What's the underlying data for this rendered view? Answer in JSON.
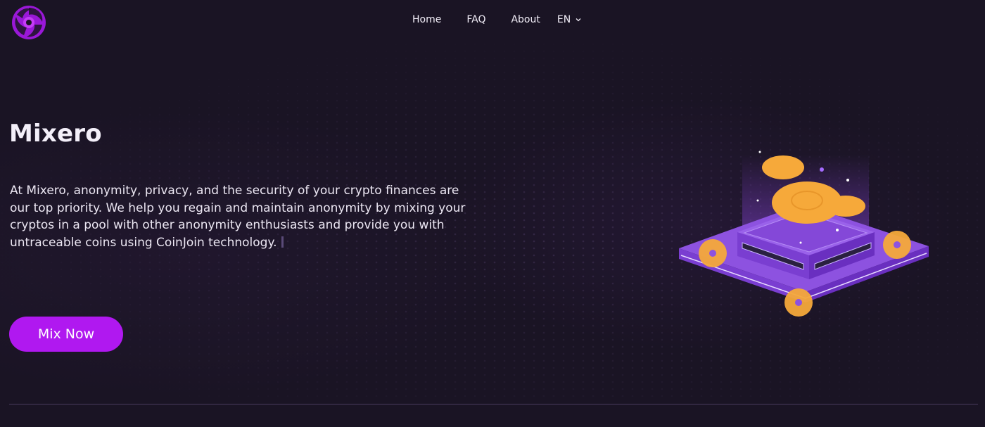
{
  "brand": {
    "accent": "#b018f0",
    "background": "#1a1424",
    "logo_icon": "swirl-logo-icon"
  },
  "nav": {
    "items": [
      {
        "label": "Home"
      },
      {
        "label": "FAQ"
      },
      {
        "label": "About"
      }
    ],
    "language": {
      "label": "EN",
      "icon": "chevron-down-icon"
    }
  },
  "hero": {
    "title": "Mixero",
    "description": "At Mixero, anonymity, privacy, and the security of your crypto finances are our top priority. We help you regain and maintain anonymity by mixing your cryptos in a pool with other anonymity enthusiasts and provide you with untraceable coins using CoinJoin technology.",
    "cta_label": "Mix Now",
    "illustration_icon": "isometric-coin-mixer-illustration"
  }
}
